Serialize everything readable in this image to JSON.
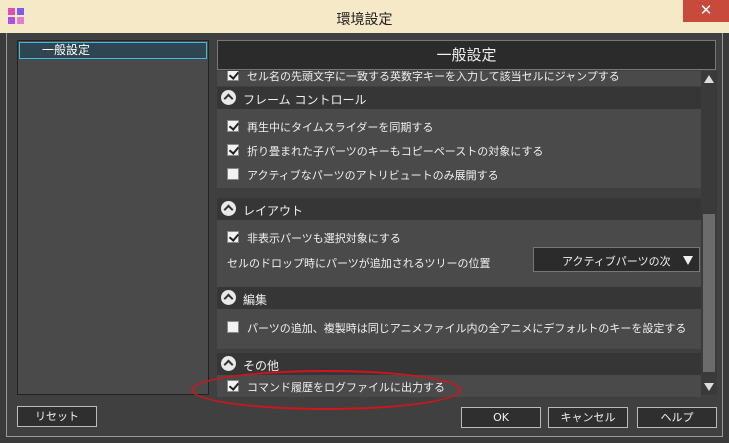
{
  "window": {
    "title": "環境設定",
    "close_glyph": "✕"
  },
  "sidebar": {
    "items": [
      {
        "label": "一般設定"
      }
    ]
  },
  "main": {
    "header": "一般設定",
    "partial_row": {
      "label": "セル名の先頭文字に一致する英数字キーを入力して該当セルにジャンプする",
      "checked": true
    },
    "sections": [
      {
        "title": "フレーム コントロール",
        "rows": [
          {
            "label": "再生中にタイムスライダーを同期する",
            "checked": true
          },
          {
            "label": "折り畳まれた子パーツのキーもコピーペーストの対象にする",
            "checked": true
          },
          {
            "label": "アクティブなパーツのアトリビュートのみ展開する",
            "checked": false
          }
        ]
      },
      {
        "title": "レイアウト",
        "rows": [
          {
            "label": "非表示パーツも選択対象にする",
            "checked": true
          }
        ],
        "setting": {
          "label": "セルのドロップ時にパーツが追加されるツリーの位置",
          "value": "アクティブパーツの次"
        }
      },
      {
        "title": "編集",
        "rows": [
          {
            "label": "パーツの追加、複製時は同じアニメファイル内の全アニメにデフォルトのキーを設定する",
            "checked": false
          }
        ]
      },
      {
        "title": "その他",
        "rows": [
          {
            "label": "コマンド履歴をログファイルに出力する",
            "checked": true
          }
        ]
      }
    ]
  },
  "footer": {
    "reset_label": "リセット",
    "ok_label": "OK",
    "cancel_label": "キャンセル",
    "help_label": "ヘルプ"
  },
  "colors": {
    "accent": "#3fb9e4",
    "annotation": "#d3141a"
  }
}
